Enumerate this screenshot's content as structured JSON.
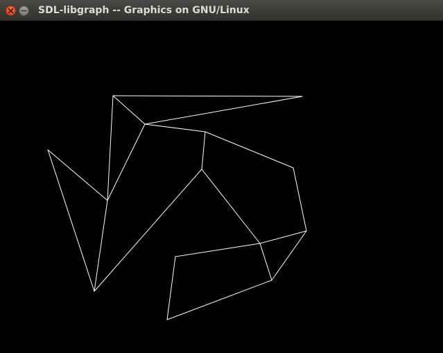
{
  "window": {
    "title": "SDL-libgraph -- Graphics on GNU/Linux",
    "buttons": {
      "close_icon": "close-icon",
      "minimize_icon": "minimize-icon"
    }
  },
  "canvas": {
    "background_color": "#000000",
    "line_color": "#ffffff"
  }
}
